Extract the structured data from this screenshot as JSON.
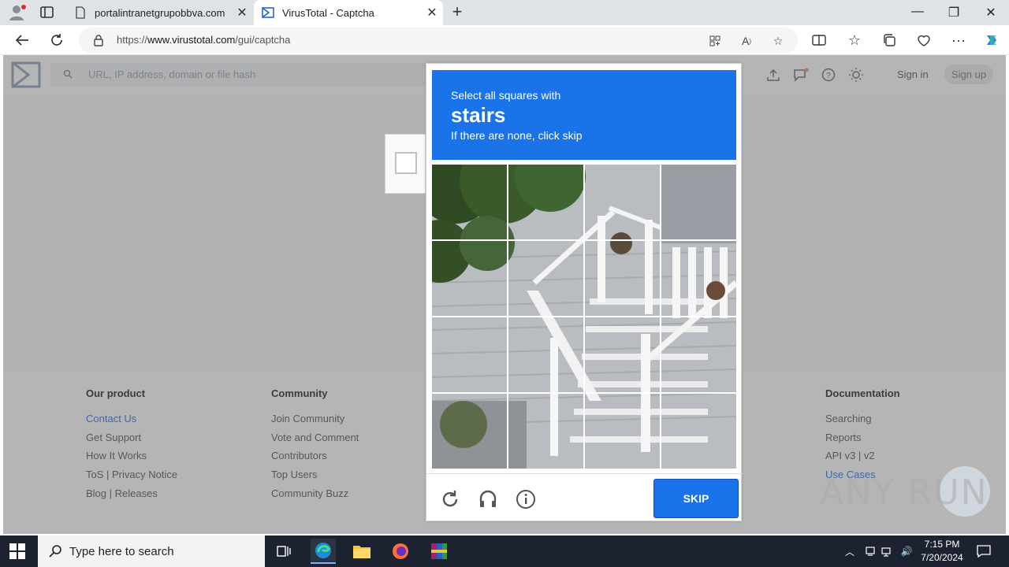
{
  "browser": {
    "tabs": [
      {
        "label": "portalintranetgrupobbva.com",
        "icon": "page-icon"
      },
      {
        "label": "VirusTotal - Captcha",
        "icon": "virustotal-icon"
      }
    ],
    "new_tab": "+",
    "url_prefix": "https://",
    "url_host": "www.virustotal.com",
    "url_path": "/gui/captcha"
  },
  "virustotal": {
    "search_placeholder": "URL, IP address, domain or file hash",
    "sign_in": "Sign in",
    "sign_up": "Sign up"
  },
  "footer": {
    "columns": [
      {
        "title": "Our product",
        "links": [
          "Contact Us",
          "Get Support",
          "How It Works",
          "ToS | Privacy Notice",
          "Blog | Releases"
        ]
      },
      {
        "title": "Community",
        "links": [
          "Join Community",
          "Vote and Comment",
          "Contributors",
          "Top Users",
          "Community Buzz"
        ]
      },
      {
        "title": "Documentation",
        "links": [
          "Searching",
          "Reports",
          "API v3 | v2",
          "Use Cases"
        ]
      }
    ]
  },
  "captcha": {
    "prompt_line1": "Select all squares with",
    "prompt_target": "stairs",
    "prompt_line3": "If there are none, click skip",
    "skip_label": "SKIP",
    "accent_color": "#1a73e8"
  },
  "watermark": "ANY RUN",
  "taskbar": {
    "search_placeholder": "Type here to search",
    "time": "7:15 PM",
    "date": "7/20/2024"
  }
}
